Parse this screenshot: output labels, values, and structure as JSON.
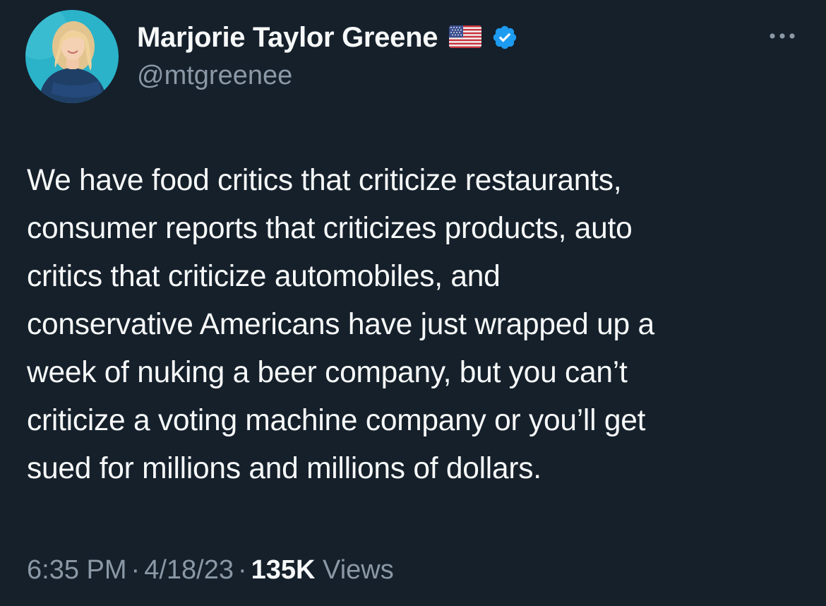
{
  "author": {
    "display_name": "Marjorie Taylor Greene",
    "handle": "@mtgreenee",
    "flag_icon": "us-flag-icon",
    "verified_icon": "verified-badge-icon",
    "verified_color": "#1d9bf0"
  },
  "tweet": {
    "lines": [
      "We have food critics that criticize restaurants,",
      "consumer reports that criticizes products, auto",
      "critics that criticize automobiles, and",
      "conservative Americans have just wrapped up a",
      "week of nuking a beer company, but you can’t",
      "criticize a voting machine company or you’ll get",
      "sued for millions and millions of dollars."
    ]
  },
  "meta": {
    "time": "6:35 PM",
    "separator": "·",
    "date": "4/18/23",
    "views_count": "135K",
    "views_label": "Views"
  },
  "theme": {
    "background": "#15202b",
    "primary_text": "#f7f9f9",
    "secondary_text": "#8b98a5",
    "accent": "#1d9bf0"
  }
}
